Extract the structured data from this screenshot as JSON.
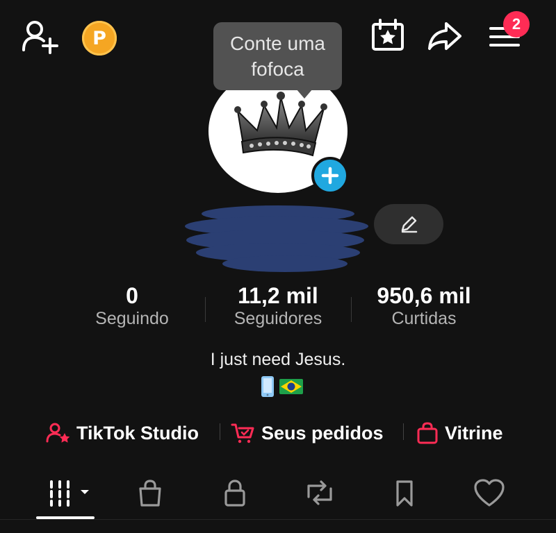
{
  "header": {
    "coin_letter": "P",
    "notification_count": "2",
    "icons": [
      "add-friend-icon",
      "coin-icon",
      "calendar-star-icon",
      "share-icon",
      "menu-icon"
    ]
  },
  "tooltip": {
    "text": "Conte uma fofoca"
  },
  "profile": {
    "avatar_description": "crown-image",
    "name_redacted": true
  },
  "stats": [
    {
      "value": "0",
      "label": "Seguindo"
    },
    {
      "value": "11,2 mil",
      "label": "Seguidores"
    },
    {
      "value": "950,6 mil",
      "label": "Curtidas"
    }
  ],
  "bio": {
    "text": "I just need Jesus.",
    "emojis": [
      "mobile-phone",
      "brazil-flag"
    ]
  },
  "links": [
    {
      "label": "TikTok Studio",
      "icon": "studio-user-star-icon"
    },
    {
      "label": "Seus pedidos",
      "icon": "cart-check-icon"
    },
    {
      "label": "Vitrine",
      "icon": "shopping-bag-icon"
    }
  ],
  "tabs": [
    {
      "name": "videos",
      "icon": "grid-icon",
      "selected": true
    },
    {
      "name": "shop",
      "icon": "bag-icon"
    },
    {
      "name": "private",
      "icon": "lock-icon"
    },
    {
      "name": "reposts",
      "icon": "repost-icon"
    },
    {
      "name": "favorites",
      "icon": "bookmark-icon"
    },
    {
      "name": "liked",
      "icon": "heart-icon"
    }
  ],
  "colors": {
    "background": "#121212",
    "accent_red": "#fe2c55",
    "coin": "#f5a623",
    "add_avatar": "#20a8e0",
    "tooltip": "#525252",
    "redaction": "#2b3f73"
  }
}
